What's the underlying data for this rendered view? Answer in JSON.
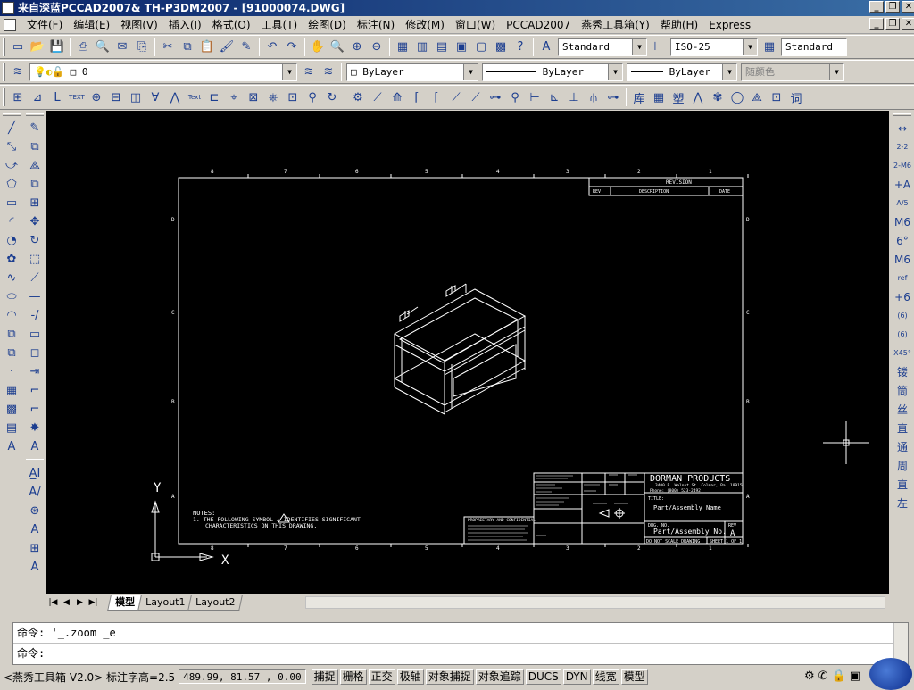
{
  "window": {
    "title": "来自深蓝PCCAD2007& TH-P3DM2007 - [91000074.DWG]",
    "buttons": [
      "_",
      "❐",
      "✕"
    ]
  },
  "menu": {
    "items": [
      "文件(F)",
      "编辑(E)",
      "视图(V)",
      "插入(I)",
      "格式(O)",
      "工具(T)",
      "绘图(D)",
      "标注(N)",
      "修改(M)",
      "窗口(W)",
      "PCCAD2007",
      "燕秀工具箱(Y)",
      "帮助(H)",
      "Express"
    ],
    "doc_buttons": [
      "_",
      "❐",
      "✕"
    ]
  },
  "standard_toolbar": {
    "icons": [
      "new-icon",
      "open-icon",
      "save-icon",
      "print-icon",
      "preview-icon",
      "publish-icon",
      "plot-icon",
      "cut-icon",
      "copy-icon",
      "paste-icon",
      "matchprop-icon",
      "blockedit-icon",
      "undo-icon",
      "redo-icon",
      "pan-icon",
      "zoom-realtime-icon",
      "zoom-window-icon",
      "zoom-previous-icon",
      "properties-icon",
      "designcenter-icon",
      "toolpalettes-icon",
      "sheetset-icon",
      "markup-icon",
      "calculator-icon",
      "help-icon"
    ],
    "glyphs": [
      "▭",
      "📂",
      "💾",
      "⎙",
      "🔍",
      "✉",
      "⎘",
      "✂",
      "⧉",
      "📋",
      "🖌",
      "✎",
      "↶",
      "↷",
      "✋",
      "🔍",
      "⊕",
      "⊖",
      "▦",
      "▥",
      "▤",
      "▣",
      "▢",
      "▩",
      "?"
    ],
    "text_style": "Standard",
    "dim_style": "ISO-25",
    "table_style": "Standard"
  },
  "layers_toolbar": {
    "layer_value": "0",
    "color_value": "ByLayer",
    "linetype_value": "ByLayer",
    "lineweight_value": "ByLayer",
    "plotstyle_value": "随颜色"
  },
  "pccad_toolbar": {
    "glyphs": [
      "⊞",
      "⊿",
      "Ⅼ",
      "TEXT",
      "⊕",
      "⊟",
      "◫",
      "∀",
      "⋀",
      "Text",
      "⊏",
      "⌖",
      "⊠",
      "⎈",
      "⊡",
      "⚲",
      "↻",
      "⚙",
      "⟋",
      "⟰",
      "⌈",
      "⌈",
      "⟋",
      "⟋",
      "⊶",
      "⚲",
      "⊢",
      "⊾",
      "⊥",
      "⫛",
      "⊶",
      "库",
      "▦",
      "塑",
      "⋀",
      "✾",
      "◯",
      "⟁",
      "⊡",
      "词"
    ]
  },
  "left_draw_toolbar": [
    "╱",
    "⤡",
    "⤻",
    "⬠",
    "▭",
    "◜",
    "◔",
    "✿",
    "∿",
    "⬭",
    "◠",
    "⧉",
    "⧉",
    "·",
    "▦",
    "▩",
    "▤",
    "A"
  ],
  "left_modify_toolbar": [
    "✎",
    "⧉",
    "⟁",
    "⧉",
    "⊞",
    "✥",
    "↻",
    "⬚",
    "⟋",
    "—",
    "-/",
    "▭",
    "◻",
    "⇥",
    "⌐",
    "⌐",
    "✸",
    "A",
    "A̲I",
    "A/",
    "⊛",
    "A",
    "⊞",
    "A"
  ],
  "right_dim_toolbar": [
    "↔",
    "2-2",
    "2-M6",
    "+A",
    "A/5",
    "M6",
    "6°",
    "M6",
    "ref",
    "+6",
    "(6)",
    "(6)",
    "X45°",
    "镂",
    "筒",
    "丝",
    "直",
    "通",
    "周",
    "直",
    "左"
  ],
  "drawing": {
    "zone_numbers_top": [
      "8",
      "7",
      "6",
      "5",
      "4",
      "3",
      "2",
      "1"
    ],
    "zone_letters_side": [
      "D",
      "C",
      "B",
      "A"
    ],
    "revision_title": "REVISION",
    "revision_headers": [
      "REV.",
      "DESCRIPTION",
      "DATE"
    ],
    "notes_title": "NOTES:",
    "notes_line1": "1. THE FOLLOWING SYMBOL   ⚠ IDENTIFIES SIGNIFICANT",
    "notes_line2": "CHARACTERISTICS ON THIS DRAWING.",
    "company": "DORMAN PRODUCTS",
    "company_addr": "3400 E. Walnut St. Colmar, Pa. 18915",
    "company_phone": "Phone: (800) 523-2492",
    "title_label": "TITLE:",
    "title_value": "Part/Assembly Name",
    "dwg_label": "DWG. NO.",
    "dwg_value": "Part/Assembly No.",
    "rev_label": "REV",
    "rev_value": "A",
    "scale_label": "DO NOT SCALE DRAWING",
    "sheet_label": "SHEET 1 OF 1",
    "prop_label": "PROPRIETARY AND CONFIDENTIAL",
    "ucs_x": "X",
    "ucs_y": "Y"
  },
  "tabs": [
    "模型",
    "Layout1",
    "Layout2"
  ],
  "command": {
    "line1_prompt": "命令:",
    "line1_text": "'_.zoom _e",
    "line2_prompt": "命令:"
  },
  "status": {
    "app_text": "<燕秀工具箱 V2.0> 标注字高=2.5",
    "coords": "489.99, 81.57 , 0.00",
    "buttons": [
      "捕捉",
      "栅格",
      "正交",
      "极轴",
      "对象捕捉",
      "对象追踪",
      "DUCS",
      "DYN",
      "线宽",
      "模型"
    ]
  },
  "colors": {
    "canvas": "#000000",
    "drawing_lines": "#ffffff",
    "title_bar": "#0a246a",
    "icon_blue": "#1b3d8f"
  }
}
